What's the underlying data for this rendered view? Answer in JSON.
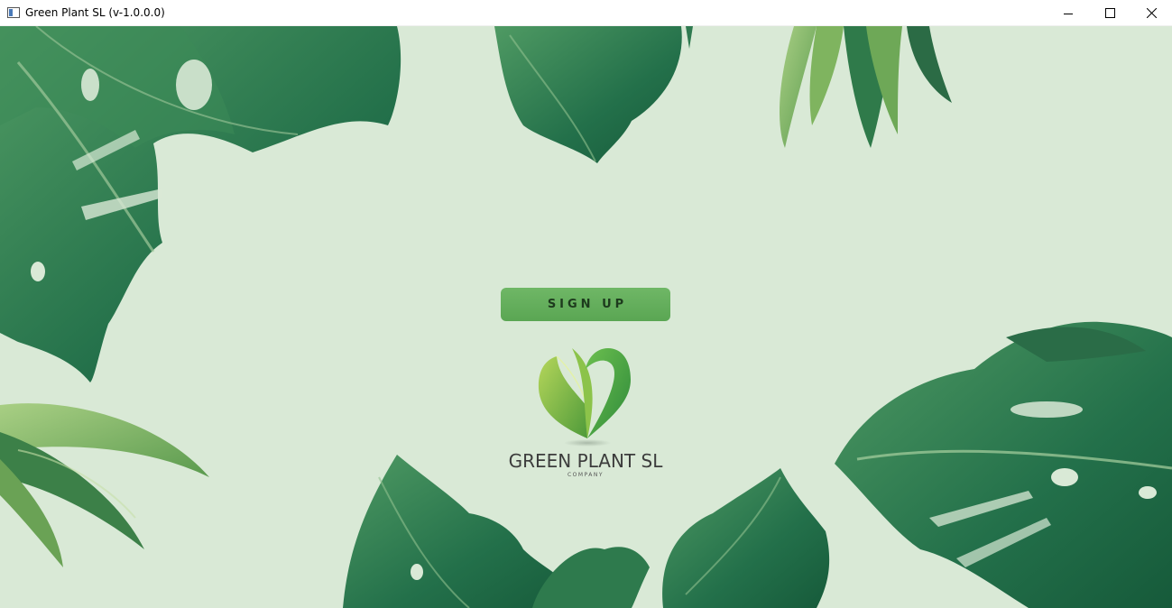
{
  "window": {
    "title": "Green Plant SL (v-1.0.0.0)",
    "controls": {
      "minimize": "minimize-icon",
      "maximize": "maximize-icon",
      "close": "close-icon"
    }
  },
  "main": {
    "signup_label": "SIGN UP",
    "logo": {
      "name": "GREEN PLANT SL",
      "tagline": "COMPANY"
    }
  },
  "colors": {
    "background": "#d9e9d6",
    "button": "#5fab58",
    "button_text": "#1d3a1d",
    "leaf_dark": "#1f6b45",
    "leaf_mid": "#3f8a5a",
    "leaf_light": "#7eb26a"
  }
}
